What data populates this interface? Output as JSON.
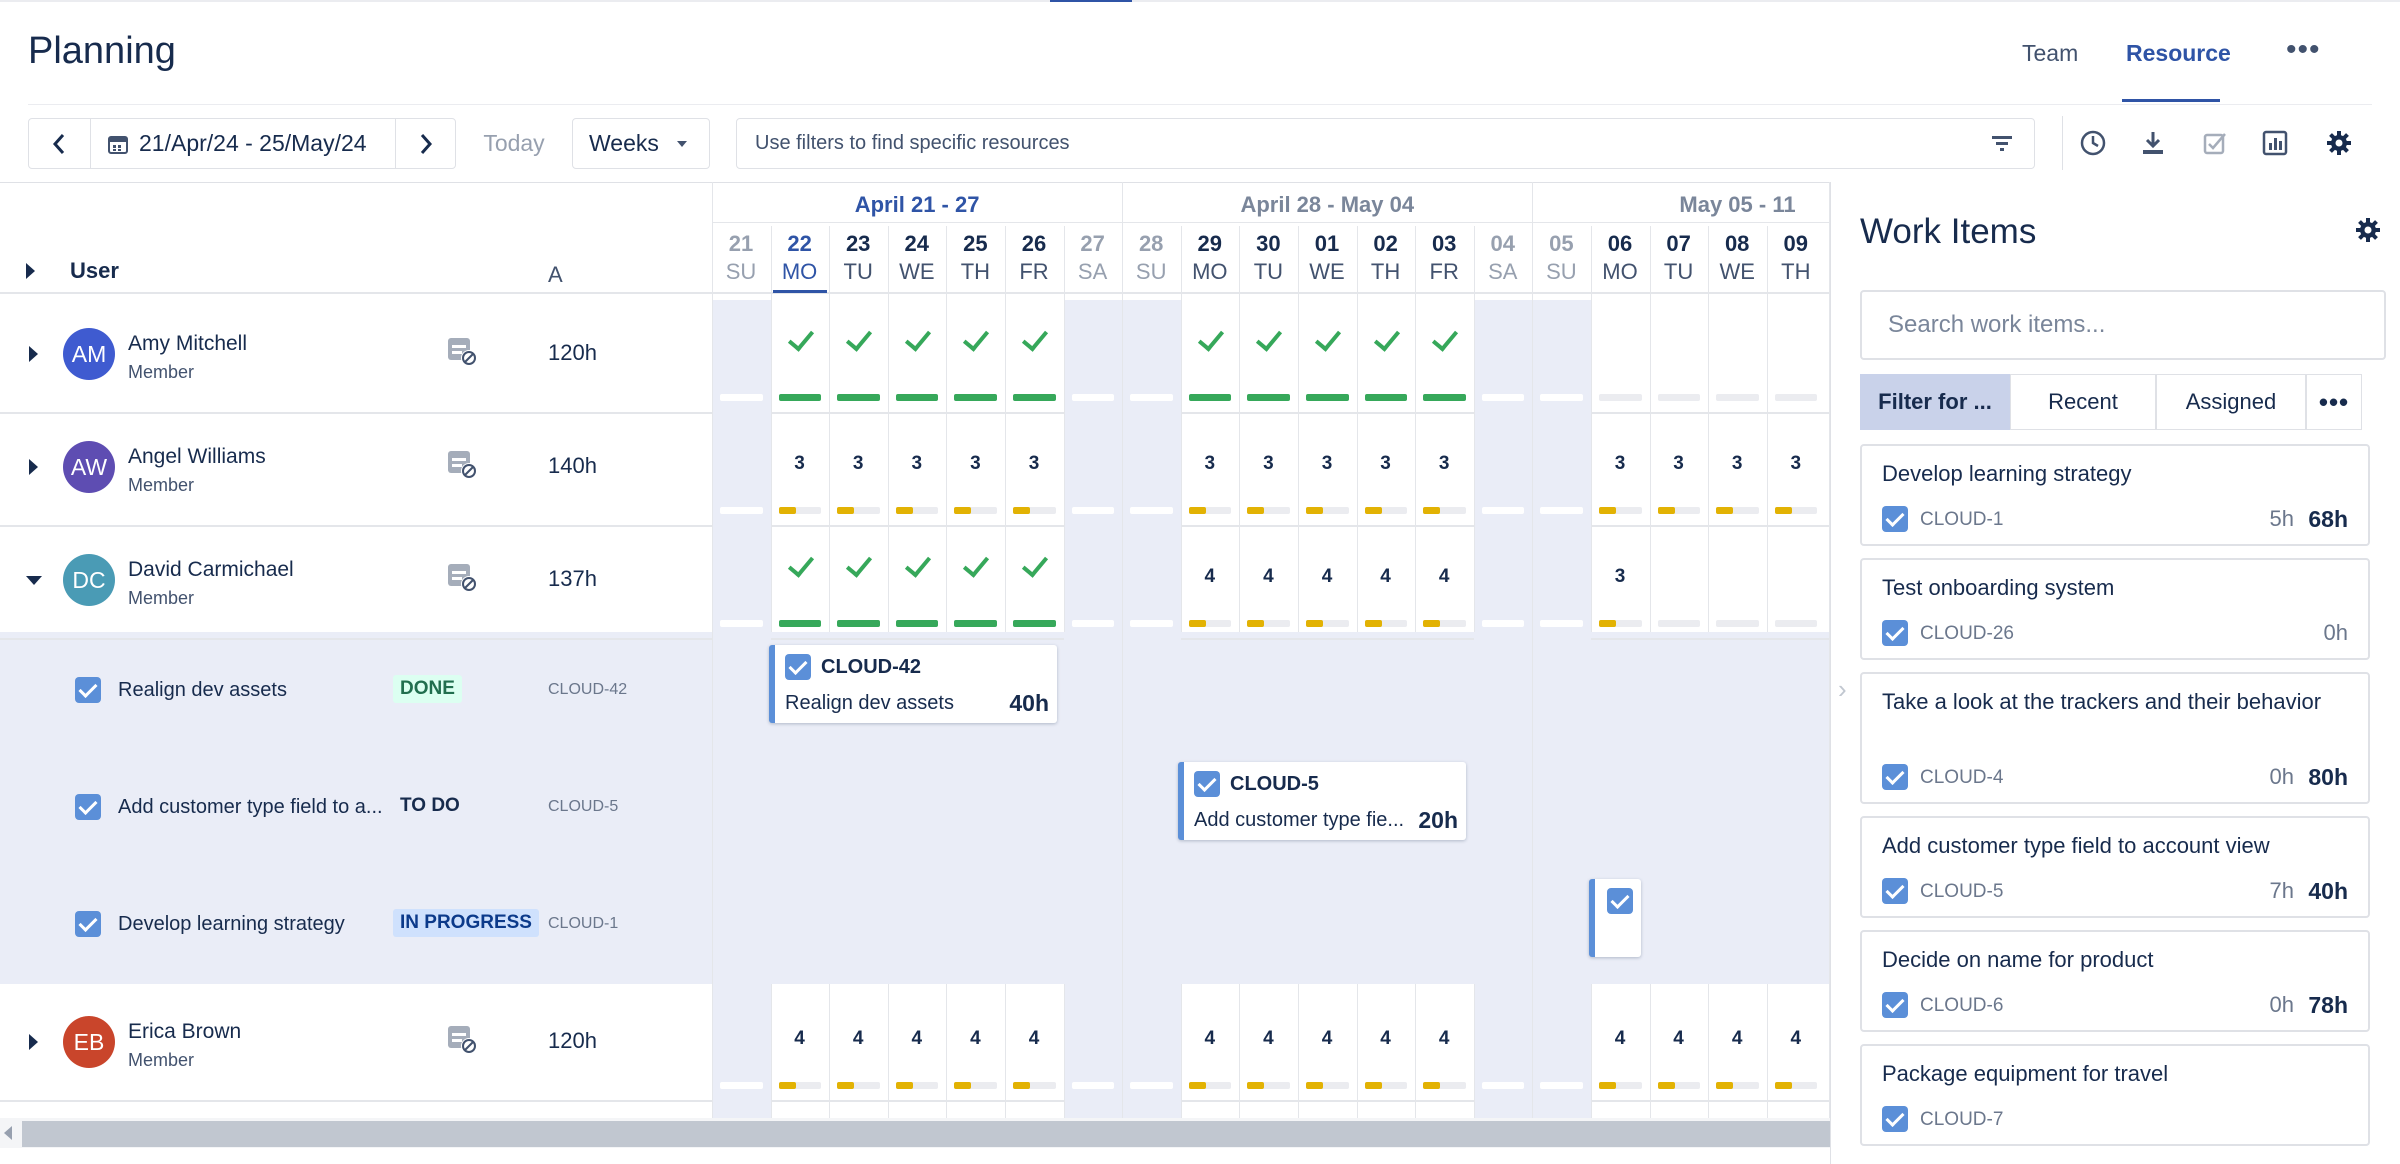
{
  "header": {
    "title": "Planning",
    "tabs": {
      "team": "Team",
      "resource": "Resource"
    },
    "more": "•••"
  },
  "toolbar": {
    "date_range": "21/Apr/24 - 25/May/24",
    "today": "Today",
    "view": "Weeks",
    "filter_placeholder": "Use filters to find specific resources"
  },
  "grid": {
    "user_header": "User",
    "avail_header": "A",
    "weeks": [
      "April 21 - 27",
      "April 28 - May 04",
      "May 05 - 11"
    ],
    "days": [
      {
        "num": "21",
        "name": "SU"
      },
      {
        "num": "22",
        "name": "MO"
      },
      {
        "num": "23",
        "name": "TU"
      },
      {
        "num": "24",
        "name": "WE"
      },
      {
        "num": "25",
        "name": "TH"
      },
      {
        "num": "26",
        "name": "FR"
      },
      {
        "num": "27",
        "name": "SA"
      },
      {
        "num": "28",
        "name": "SU"
      },
      {
        "num": "29",
        "name": "MO"
      },
      {
        "num": "30",
        "name": "TU"
      },
      {
        "num": "01",
        "name": "WE"
      },
      {
        "num": "02",
        "name": "TH"
      },
      {
        "num": "03",
        "name": "FR"
      },
      {
        "num": "04",
        "name": "SA"
      },
      {
        "num": "05",
        "name": "SU"
      },
      {
        "num": "06",
        "name": "MO"
      },
      {
        "num": "07",
        "name": "TU"
      },
      {
        "num": "08",
        "name": "WE"
      },
      {
        "num": "09",
        "name": "TH"
      }
    ],
    "users": [
      {
        "initials": "AM",
        "name": "Amy Mitchell",
        "role": "Member",
        "hours": "120h",
        "color": "#3f5bd0",
        "cells": [
          "",
          "check",
          "check",
          "check",
          "check",
          "check",
          "",
          "",
          "check",
          "check",
          "check",
          "check",
          "check",
          "",
          "",
          "",
          "",
          "",
          ""
        ]
      },
      {
        "initials": "AW",
        "name": "Angel Williams",
        "role": "Member",
        "hours": "140h",
        "color": "#5e4db2",
        "cells": [
          "",
          "3",
          "3",
          "3",
          "3",
          "3",
          "",
          "",
          "3",
          "3",
          "3",
          "3",
          "3",
          "",
          "",
          "3",
          "3",
          "3",
          "3"
        ]
      },
      {
        "initials": "DC",
        "name": "David Carmichael",
        "role": "Member",
        "hours": "137h",
        "color": "#4a9bb5",
        "cells": [
          "",
          "check",
          "check",
          "check",
          "check",
          "check",
          "",
          "",
          "4",
          "4",
          "4",
          "4",
          "4",
          "",
          "",
          "3",
          "",
          "",
          ""
        ]
      },
      {
        "initials": "EB",
        "name": "Erica Brown",
        "role": "Member",
        "hours": "120h",
        "color": "#c9452b",
        "cells": [
          "",
          "4",
          "4",
          "4",
          "4",
          "4",
          "",
          "",
          "4",
          "4",
          "4",
          "4",
          "4",
          "",
          "",
          "4",
          "4",
          "4",
          "4"
        ]
      }
    ],
    "subtasks": [
      {
        "name": "Realign dev assets",
        "status": "DONE",
        "key": "CLOUD-42",
        "card_name": "Realign dev assets",
        "card_hours": "40h"
      },
      {
        "name": "Add customer type field to a...",
        "status": "TO DO",
        "key": "CLOUD-5",
        "card_name": "Add customer type fie...",
        "card_hours": "20h"
      },
      {
        "name": "Develop learning strategy",
        "status": "IN PROGRESS",
        "key": "CLOUD-1"
      }
    ]
  },
  "panel": {
    "title": "Work Items",
    "search_placeholder": "Search work items...",
    "filters": [
      "Filter for ...",
      "Recent",
      "Assigned"
    ],
    "filter_more": "•••",
    "items": [
      {
        "title": "Develop learning strategy",
        "key": "CLOUD-1",
        "spent": "5h",
        "estimate": "68h"
      },
      {
        "title": "Test onboarding system",
        "key": "CLOUD-26",
        "spent": "0h",
        "estimate": ""
      },
      {
        "title": "Take a look at the trackers and their behavior",
        "key": "CLOUD-4",
        "spent": "0h",
        "estimate": "80h"
      },
      {
        "title": "Add customer type field to account view",
        "key": "CLOUD-5",
        "spent": "7h",
        "estimate": "40h"
      },
      {
        "title": "Decide on name for product",
        "key": "CLOUD-6",
        "spent": "0h",
        "estimate": "78h"
      },
      {
        "title": "Package equipment for travel",
        "key": "CLOUD-7",
        "spent": "",
        "estimate": ""
      }
    ]
  },
  "colors": {
    "accent": "#2f54a6",
    "check_green": "#36a85a",
    "bar_green": "#36a85a",
    "bar_yellow": "#e2b203",
    "checkbox_blue": "#5b8fd8"
  }
}
